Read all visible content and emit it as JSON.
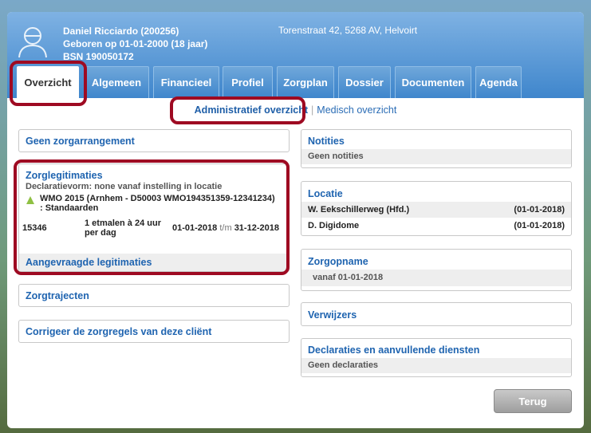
{
  "patient": {
    "name": "Daniel Ricciardo (200256)",
    "dob": "Geboren op 01-01-2000 (18 jaar)",
    "bsn": "BSN 190050172",
    "address": "Torenstraat 42, 5268 AV, Helvoirt"
  },
  "tabs": [
    "Overzicht",
    "Algemeen",
    "Financieel",
    "Profiel",
    "Zorgplan",
    "Dossier",
    "Documenten",
    "Agenda"
  ],
  "subnav": {
    "active": "Administratief overzicht",
    "separator": "|",
    "other": "Medisch overzicht"
  },
  "left": {
    "zorgarrangement": "Geen zorgarrangement",
    "legitimaties": {
      "title": "Zorglegitimaties",
      "declaratievorm": "Declaratievorm: none vanaf instelling in locatie",
      "wmo_line1": "WMO 2015 (Arnhem - D50003 WMO194351359-12341234)",
      "wmo_line2": ": Standaarden",
      "code": "15346",
      "desc1": "1 etmalen à 24 uur",
      "desc2": "per dag",
      "date_from": "01-01-2018",
      "tm": "t/m",
      "date_to": "31-12-2018",
      "aangevraagd": "Aangevraagde legitimaties"
    },
    "zorgtrajecten": "Zorgtrajecten",
    "corrigeer": "Corrigeer de zorgregels van deze cliënt"
  },
  "right": {
    "notities": {
      "title": "Notities",
      "body": "Geen notities"
    },
    "locatie": {
      "title": "Locatie",
      "rows": [
        {
          "name": "W. Eekschillerweg (Hfd.)",
          "date": "(01-01-2018)"
        },
        {
          "name": "D. Digidome",
          "date": "(01-01-2018)"
        }
      ]
    },
    "zorgopname": {
      "title": "Zorgopname",
      "body": "vanaf 01-01-2018"
    },
    "verwijzers": {
      "title": "Verwijzers"
    },
    "declaraties": {
      "title": "Declaraties en aanvullende diensten",
      "body": "Geen declaraties"
    }
  },
  "buttons": {
    "terug": "Terug"
  }
}
